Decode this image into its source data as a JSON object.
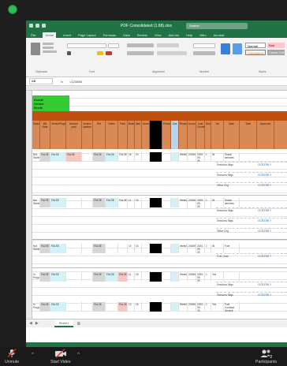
{
  "excel": {
    "window_title": "PDF Consolidated (1.88).xlsx",
    "search_placeholder": "Search",
    "menu": [
      "File",
      "Home",
      "Insert",
      "Page Layout",
      "Formulas",
      "Data",
      "Review",
      "View",
      "Add-ins",
      "Help",
      "Nitro",
      "Acrobat"
    ],
    "active_menu": "Home",
    "ribbon": {
      "font_name": "Arial",
      "font_size": "8",
      "number_format": "General",
      "wrap_text": "Wrap Text",
      "merge_center": "Merge & Center",
      "styles": {
        "normal": "Normal",
        "bad": "Bad",
        "calculation": "Calculation",
        "check_cell": "Check Cell"
      },
      "groups": [
        "Clipboard",
        "Font",
        "Alignment",
        "Number",
        "Styles"
      ]
    },
    "formula_bar": {
      "name_box": "AB",
      "fx": "fx",
      "value": "=123456"
    },
    "sheet": {
      "title_lines": [
        "Assets",
        "Vendor",
        "Month"
      ],
      "title_suffix": "Template",
      "headers": [
        "Status",
        "Bill Date",
        "Vendor/Payee",
        "Amount paid",
        "Invoice number",
        "Ref",
        "Notes",
        "Paid",
        "Balance",
        "Item",
        "Amount",
        "Period",
        "Due",
        "Received",
        "Account",
        "Cost Centre",
        "Department",
        "Tax",
        "Date",
        "Total",
        "Approved",
        "Comments",
        "Fund",
        "Source"
      ],
      "records": [
        {
          "status": "Not Started",
          "date": "FALSE",
          "payee": "FALSE",
          "ref": "FALSE",
          "amt": "FALSE",
          "n1": "18",
          "n2": "20",
          "sched": "Weekly",
          "num": "234569",
          "date2": "2020-09-25",
          "q": "1",
          "tag": "IN",
          "dept": "Social services",
          "sub1": "Sessions Mtgs",
          "sub2": "Sessions Mtgs",
          "sub3": "Office Chg",
          "link": "OCR3789 Y"
        },
        {
          "status": "Not Started",
          "date": "FALSE",
          "payee": "FALSE",
          "ref": "FALSE",
          "amt": "FALSE",
          "n1": "11",
          "n2": "15",
          "sched": "Weekly",
          "num": "234560",
          "date2": "2020-09-25",
          "q": "1",
          "tag": "IN",
          "dept": "Social services",
          "sub1": "Sessions Mtgs",
          "sub2": "Sessions Mtgs",
          "sub3": "Office Chg",
          "link": "OCR3789 Y"
        },
        {
          "status": "Not Started",
          "date": "FALSE",
          "payee": "FALSE",
          "ref": "FALSE",
          "amt": "FALSE",
          "n1": "10",
          "n2": "16",
          "sched": "Weekly",
          "num": "234590",
          "date2": "2020-09-25",
          "q": "1",
          "tag": "IN",
          "dept": "Fuel",
          "sub1": "Fuel Order",
          "sub2": "Sessions Mtgs",
          "sub3": "Sessions Mtgs",
          "link": "OCR3789 Y"
        },
        {
          "status": "In Progress",
          "date": "FALSE",
          "payee": "FALSE",
          "ref": "FALSE",
          "amt": "FALSE",
          "n1": "11",
          "n2": "18",
          "sched": "Weekly",
          "num": "234569",
          "date2": "2020-09-25",
          "q": "1",
          "tag": "Yes",
          "dept": "",
          "sub1": "Sessions Mtgs",
          "sub2": "Sessions Mtgs",
          "sub3": "Office Chg",
          "link": "OCR3789 Y"
        },
        {
          "status": "In Progress",
          "date": "FALSE",
          "payee": "FALSE",
          "ref": "FALSE",
          "amt": "FALSE",
          "n1": "10",
          "n2": "16",
          "sched": "Weekly",
          "num": "234567",
          "date2": "2020-09-25",
          "q": "1",
          "tag": "Yes",
          "dept": "",
          "sub1": "Fuel Contract Service",
          "sub2": "",
          "sub3": "",
          "link": ""
        }
      ],
      "tab_name": "Sheet1"
    }
  },
  "zoom_toolbar": {
    "mute_label": "Unmute",
    "video_label": "Start Video",
    "participants_label": "Participants",
    "participants_count": "2"
  },
  "colors": {
    "excel_green": "#217346",
    "title_green": "#33cc33",
    "orange_band": "#c0500d",
    "header_orange": "#d98a54",
    "mute_red": "#e02828",
    "share_green": "#2ebd4f"
  }
}
